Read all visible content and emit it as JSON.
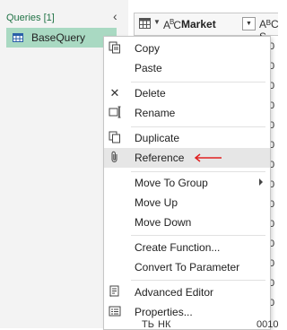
{
  "queries_pane": {
    "header": "Queries [1]",
    "items": [
      {
        "label": "BaseQuery"
      }
    ]
  },
  "grid": {
    "column_header": "Market",
    "column_type_label": "A",
    "column_type_sub": "B",
    "column_type_tail": "C",
    "next_col_type": "AᴮC S",
    "row_partial_values": [
      "0",
      "0",
      "0",
      "0",
      "0",
      "0",
      "0",
      "0",
      "0",
      "0",
      "0",
      "0",
      "0",
      "0"
    ],
    "last_row_left": "ТЬ",
    "last_row_mid": "НК",
    "last_row_right": "0010"
  },
  "context_menu": {
    "items": [
      {
        "label": "Copy",
        "icon": "copy-icon"
      },
      {
        "label": "Paste",
        "icon": "paste-icon"
      },
      {
        "label": "Delete",
        "icon": "delete-icon"
      },
      {
        "label": "Rename",
        "icon": "rename-icon"
      },
      {
        "label": "Duplicate",
        "icon": "duplicate-icon"
      },
      {
        "label": "Reference",
        "icon": "paperclip-icon",
        "highlighted": true
      },
      {
        "label": "Move To Group",
        "icon": "",
        "submenu": true
      },
      {
        "label": "Move Up",
        "icon": ""
      },
      {
        "label": "Move Down",
        "icon": ""
      },
      {
        "label": "Create Function...",
        "icon": ""
      },
      {
        "label": "Convert To Parameter",
        "icon": ""
      },
      {
        "label": "Advanced Editor",
        "icon": "advanced-editor-icon"
      },
      {
        "label": "Properties...",
        "icon": "properties-icon"
      }
    ]
  },
  "colors": {
    "accent_green": "#217346",
    "selected_query_bg": "#a9d9c2",
    "annotation_arrow": "#e02020"
  }
}
